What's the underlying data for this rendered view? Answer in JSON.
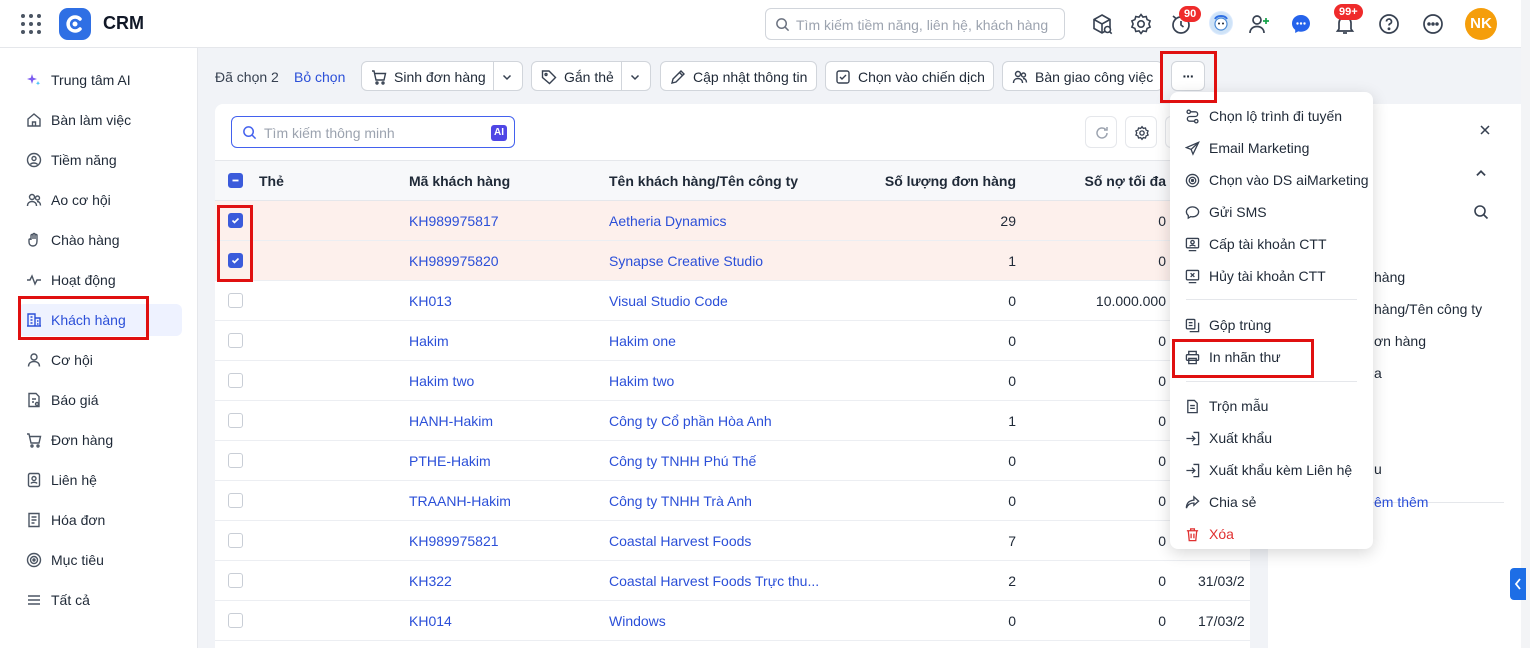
{
  "app": {
    "title": "CRM"
  },
  "header": {
    "search_placeholder": "Tìm kiếm tiềm năng, liên hệ, khách hàng",
    "badges": {
      "timer": "90",
      "notifications": "99+"
    },
    "user_initials": "NK"
  },
  "sidebar": {
    "items": [
      {
        "label": "Trung tâm AI",
        "icon": "sparkle-icon"
      },
      {
        "label": "Bàn làm việc",
        "icon": "home-icon"
      },
      {
        "label": "Tiềm năng",
        "icon": "target-person-icon"
      },
      {
        "label": "Ao cơ hội",
        "icon": "people-icon"
      },
      {
        "label": "Chào hàng",
        "icon": "hand-icon"
      },
      {
        "label": "Hoạt động",
        "icon": "pulse-icon"
      },
      {
        "label": "Khách hàng",
        "icon": "building-icon"
      },
      {
        "label": "Cơ hội",
        "icon": "person-icon"
      },
      {
        "label": "Báo giá",
        "icon": "quote-icon"
      },
      {
        "label": "Đơn hàng",
        "icon": "cart-icon"
      },
      {
        "label": "Liên hệ",
        "icon": "contact-icon"
      },
      {
        "label": "Hóa đơn",
        "icon": "invoice-icon"
      },
      {
        "label": "Mục tiêu",
        "icon": "goal-icon"
      },
      {
        "label": "Tất cả",
        "icon": "menu-icon"
      }
    ]
  },
  "actionbar": {
    "selected_label": "Đã chọn 2",
    "deselect_label": "Bỏ chọn",
    "buttons": {
      "create_order": "Sinh đơn hàng",
      "tag": "Gắn thẻ",
      "update_info": "Cập nhật thông tin",
      "campaign": "Chọn vào chiến dịch",
      "handover": "Bàn giao công việc",
      "more": "···"
    }
  },
  "table": {
    "search_placeholder": "Tìm kiếm thông minh",
    "ai_chip": "AI",
    "columns": {
      "tag": "Thẻ",
      "code": "Mã khách hàng",
      "name": "Tên khách hàng/Tên công ty",
      "orders": "Số lượng đơn hàng",
      "debt": "Số nợ tối đa"
    },
    "rows": [
      {
        "checked": true,
        "code": "KH989975817",
        "name": "Aetheria Dynamics",
        "orders": "29",
        "debt": "0",
        "date": ""
      },
      {
        "checked": true,
        "code": "KH989975820",
        "name": "Synapse Creative Studio",
        "orders": "1",
        "debt": "0",
        "date": ""
      },
      {
        "checked": false,
        "code": "KH013",
        "name": "Visual Studio Code",
        "orders": "0",
        "debt": "10.000.000",
        "date": ""
      },
      {
        "checked": false,
        "code": "Hakim",
        "name": "Hakim one",
        "orders": "0",
        "debt": "0",
        "date": ""
      },
      {
        "checked": false,
        "code": "Hakim two",
        "name": "Hakim two",
        "orders": "0",
        "debt": "0",
        "date": ""
      },
      {
        "checked": false,
        "code": "HANH-Hakim",
        "name": "Công ty Cổ phần Hòa Anh",
        "orders": "1",
        "debt": "0",
        "date": ""
      },
      {
        "checked": false,
        "code": "PTHE-Hakim",
        "name": "Công ty TNHH Phú Thế",
        "orders": "0",
        "debt": "0",
        "date": ""
      },
      {
        "checked": false,
        "code": "TRAANH-Hakim",
        "name": "Công ty TNHH Trà Anh",
        "orders": "0",
        "debt": "0",
        "date": ""
      },
      {
        "checked": false,
        "code": "KH989975821",
        "name": "Coastal Harvest Foods",
        "orders": "7",
        "debt": "0",
        "date": ""
      },
      {
        "checked": false,
        "code": "KH322",
        "name": "Coastal Harvest Foods Trực thu...",
        "orders": "2",
        "debt": "0",
        "date": "31/03/2"
      },
      {
        "checked": false,
        "code": "KH014",
        "name": "Windows",
        "orders": "0",
        "debt": "0",
        "date": "17/03/2"
      }
    ]
  },
  "right_panel": {
    "lines": [
      "hàng",
      "hàng/Tên công ty",
      "ơn hàng",
      "a",
      "u"
    ],
    "link": "êm thêm"
  },
  "more_menu": {
    "items": [
      {
        "label": "Chọn lộ trình đi tuyến",
        "icon": "route-icon"
      },
      {
        "label": "Email Marketing",
        "icon": "send-icon"
      },
      {
        "label": "Chọn vào DS aiMarketing",
        "icon": "target-icon"
      },
      {
        "label": "Gửi SMS",
        "icon": "chat-bubble-icon"
      },
      {
        "label": "Cấp tài khoản CTT",
        "icon": "portal-account-icon"
      },
      {
        "label": "Hủy tài khoản CTT",
        "icon": "close-box-icon"
      },
      {
        "label": "Gộp trùng",
        "icon": "merge-icon"
      },
      {
        "label": "In nhãn thư",
        "icon": "printer-icon"
      },
      {
        "label": "Trộn mẫu",
        "icon": "document-icon"
      },
      {
        "label": "Xuất khẩu",
        "icon": "export-icon"
      },
      {
        "label": "Xuất khẩu kèm Liên hệ",
        "icon": "export-contact-icon"
      },
      {
        "label": "Chia sẻ",
        "icon": "share-icon"
      },
      {
        "label": "Xóa",
        "icon": "trash-icon"
      }
    ]
  },
  "colors": {
    "accent": "#2b4fd8",
    "highlight_box": "#e01010",
    "selected_row": "#fdf0ec",
    "danger": "#e03131"
  }
}
